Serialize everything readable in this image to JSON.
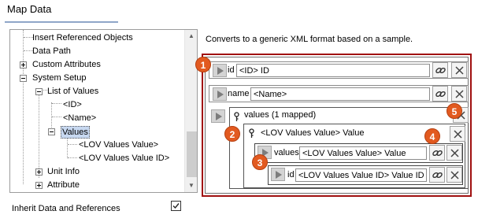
{
  "dialog": {
    "title": "Map Data",
    "description": "Converts to a generic XML format based on a sample.",
    "inherit_label": "Inherit Data and References",
    "inherit_checked": true
  },
  "tree": {
    "items": [
      {
        "label": "Insert Referenced Objects"
      },
      {
        "label": "Data Path"
      },
      {
        "label": "Custom Attributes"
      },
      {
        "label": "System Setup"
      },
      {
        "label": "List of Values"
      },
      {
        "label": "<ID>"
      },
      {
        "label": "<Name>"
      },
      {
        "label": "Values"
      },
      {
        "label": "<LOV Values Value>"
      },
      {
        "label": "<LOV Values Value ID>"
      },
      {
        "label": "Unit Info"
      },
      {
        "label": "Attribute"
      }
    ]
  },
  "mapping": {
    "id_row": {
      "label": "id",
      "value": "<ID> ID"
    },
    "name_row": {
      "label": "name",
      "value": "<Name>"
    },
    "values_group": {
      "header": "values (1 mapped)"
    },
    "value_group": {
      "header": "<LOV Values Value> Value"
    },
    "values_row": {
      "label": "values",
      "value": "<LOV Values Value> Value"
    },
    "id_inner_row": {
      "label": "id",
      "value": "<LOV Values Value ID> Value ID"
    }
  },
  "callouts": [
    "1",
    "2",
    "3",
    "4",
    "5"
  ],
  "colors": {
    "callout": "#e25a20",
    "highlight_border": "#a01010",
    "selection": "#c7d8f0"
  }
}
